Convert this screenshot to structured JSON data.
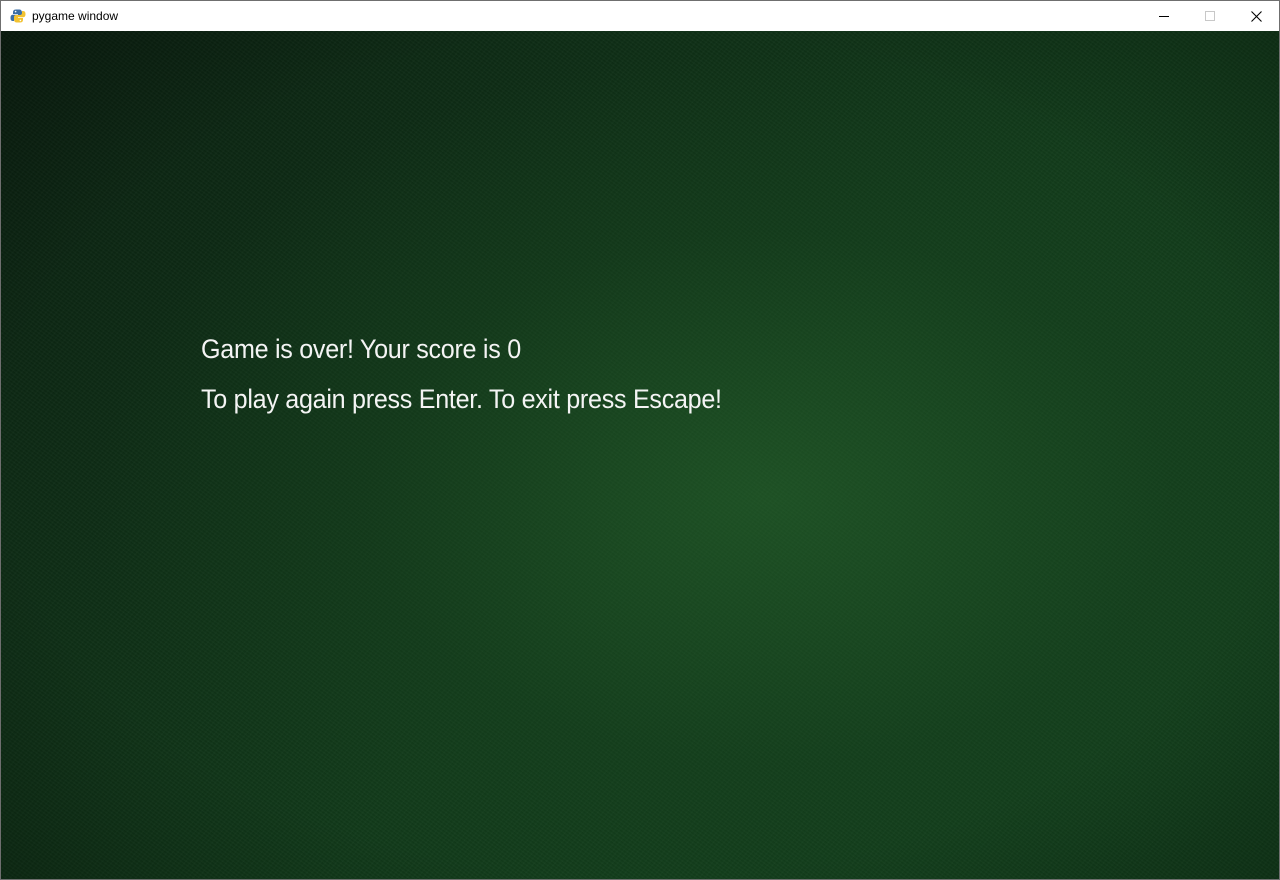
{
  "window": {
    "title": "pygame window",
    "app_icon": "pygame-snake-icon",
    "controls": {
      "minimize_icon": "minimize-icon",
      "maximize_icon": "maximize-icon",
      "close_icon": "close-icon"
    }
  },
  "game": {
    "game_over_text": "Game is over! Your score is 0",
    "instructions_text": "To play again press Enter. To exit press Escape!",
    "score": 0
  },
  "colors": {
    "background": "#113a1a",
    "text": "#f4f4f4"
  }
}
